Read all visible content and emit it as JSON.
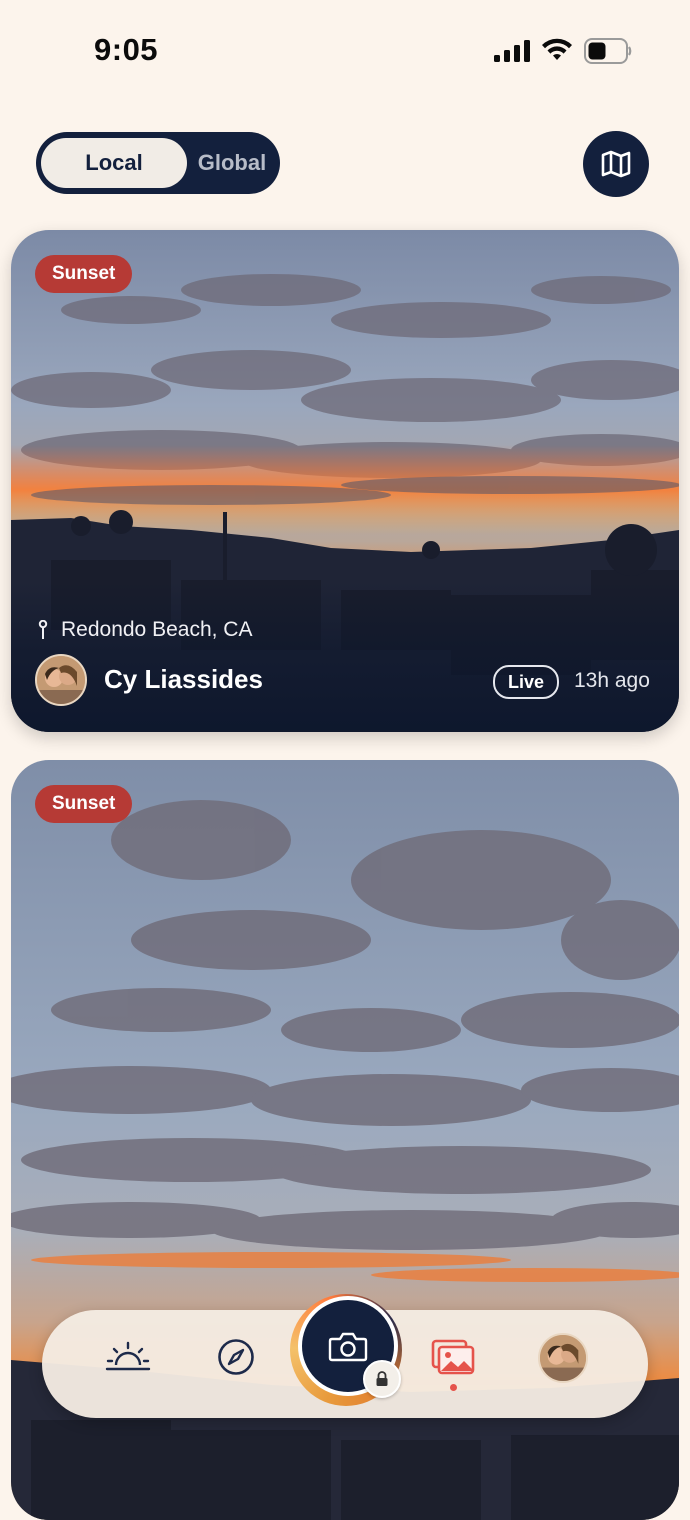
{
  "status_bar": {
    "time": "9:05"
  },
  "feed_toggle": {
    "options": [
      "Local",
      "Global"
    ],
    "selected": "Local"
  },
  "map_button": {
    "icon": "map-icon"
  },
  "posts": [
    {
      "tag": "Sunset",
      "location": "Redondo Beach, CA",
      "user": "Cy Liassides",
      "badge": "Live",
      "time_ago": "13h ago"
    },
    {
      "tag": "Sunset"
    }
  ],
  "tab_bar": {
    "items": [
      {
        "icon": "sunrise-icon",
        "active": false
      },
      {
        "icon": "compass-icon",
        "active": false
      },
      {
        "icon": "camera-icon",
        "active": false,
        "locked": true
      },
      {
        "icon": "photos-icon",
        "active": true
      },
      {
        "icon": "profile-avatar",
        "active": false
      }
    ]
  },
  "colors": {
    "background": "#fcf4ec",
    "navy": "#13203d",
    "tag_red": "#b63a35",
    "accent": "#e5534b"
  }
}
